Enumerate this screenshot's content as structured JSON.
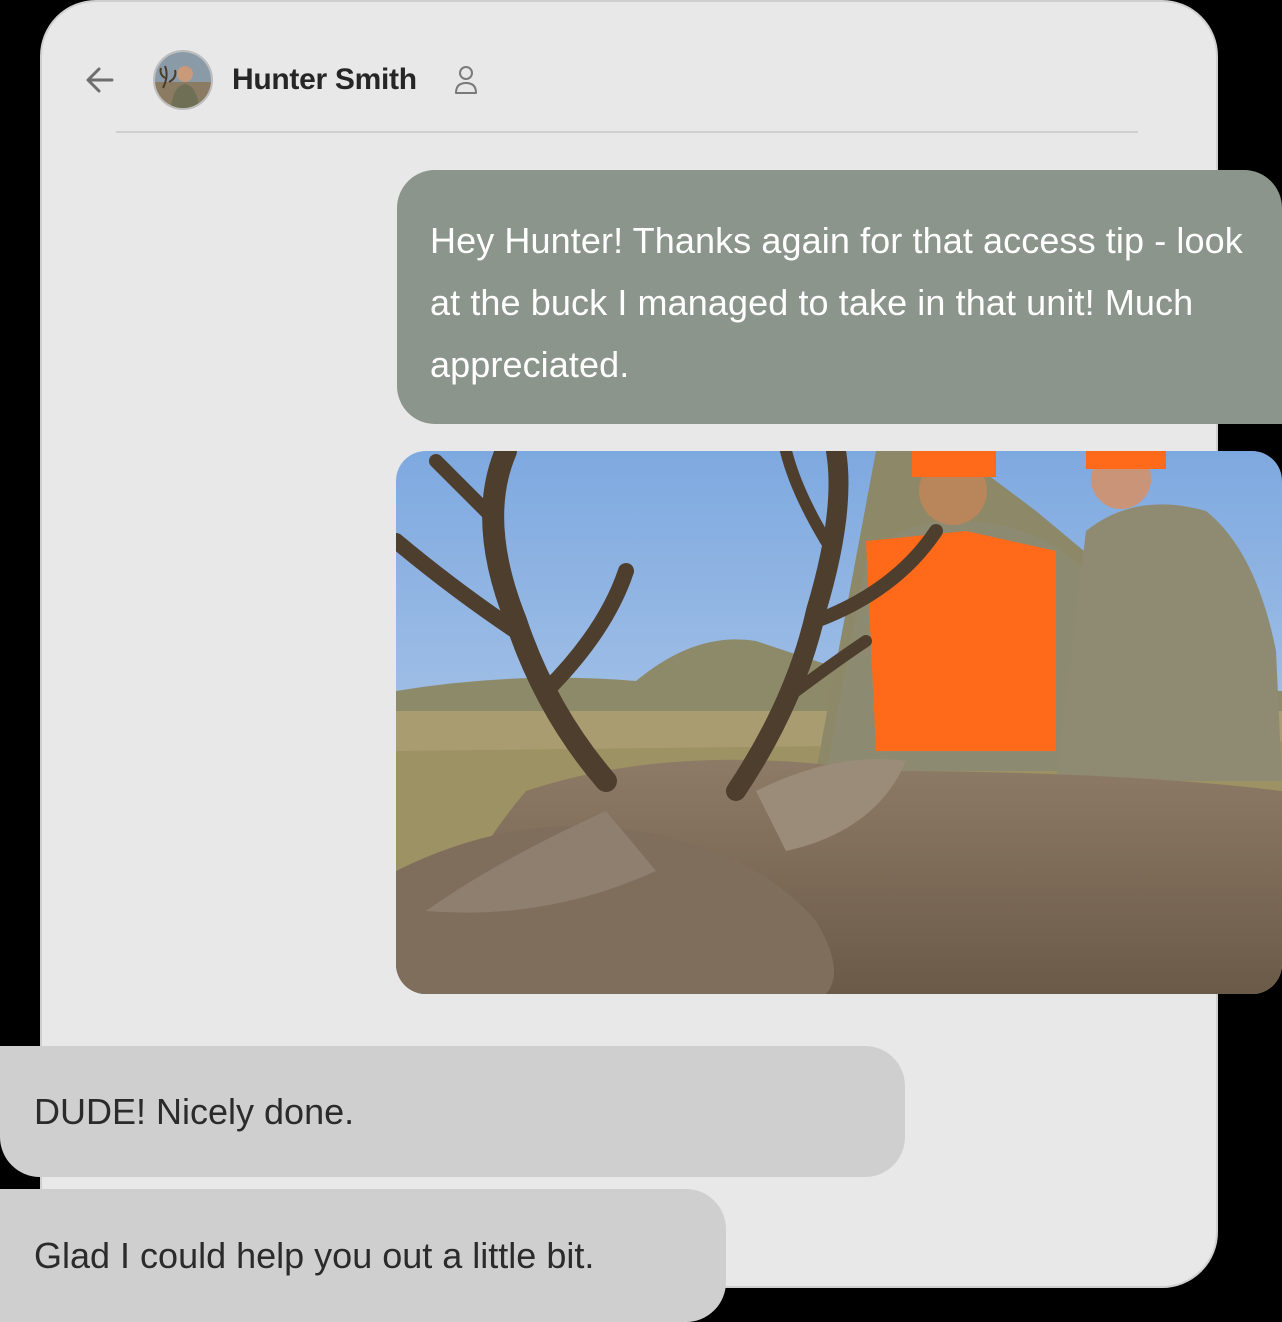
{
  "header": {
    "contact_name": "Hunter Smith",
    "back_icon": "arrow-left-icon",
    "profile_icon": "person-icon"
  },
  "messages": [
    {
      "direction": "outgoing",
      "text": "Hey Hunter! Thanks again for that access tip - look at the buck I managed to take in that unit! Much appreciated."
    },
    {
      "direction": "outgoing",
      "type": "photo"
    },
    {
      "direction": "incoming",
      "text": "DUDE! Nicely done."
    },
    {
      "direction": "incoming",
      "text": "Glad I could help you out a little bit."
    }
  ],
  "colors": {
    "outgoing_bubble": "#8b958b",
    "incoming_bubble": "#cfcfcf",
    "screen_bg": "#e8e8e8"
  }
}
